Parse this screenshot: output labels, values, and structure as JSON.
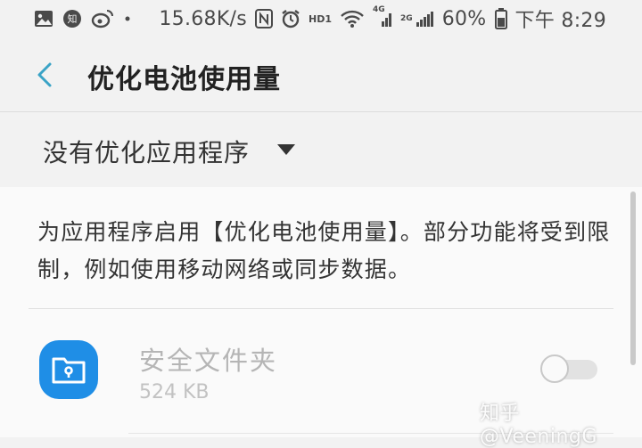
{
  "status_bar": {
    "net_speed": "15.68K/s",
    "hd_label": "HD1",
    "lte_label": "4G",
    "second_signal_label": "2G",
    "battery": "60%",
    "time": "下午 8:29"
  },
  "toolbar": {
    "title": "优化电池使用量"
  },
  "filter": {
    "selected": "没有优化应用程序"
  },
  "content": {
    "description": "为应用程序启用【优化电池使用量】。部分功能将受到限制，例如使用移动网络或同步数据。",
    "apps": [
      {
        "name": "安全文件夹",
        "size": "524 KB",
        "enabled": false
      }
    ]
  },
  "watermark": "知乎 @VeeningG",
  "colors": {
    "accent": "#1f8ee6",
    "back_arrow": "#3aa3c6",
    "background": "#f2f2f2"
  }
}
